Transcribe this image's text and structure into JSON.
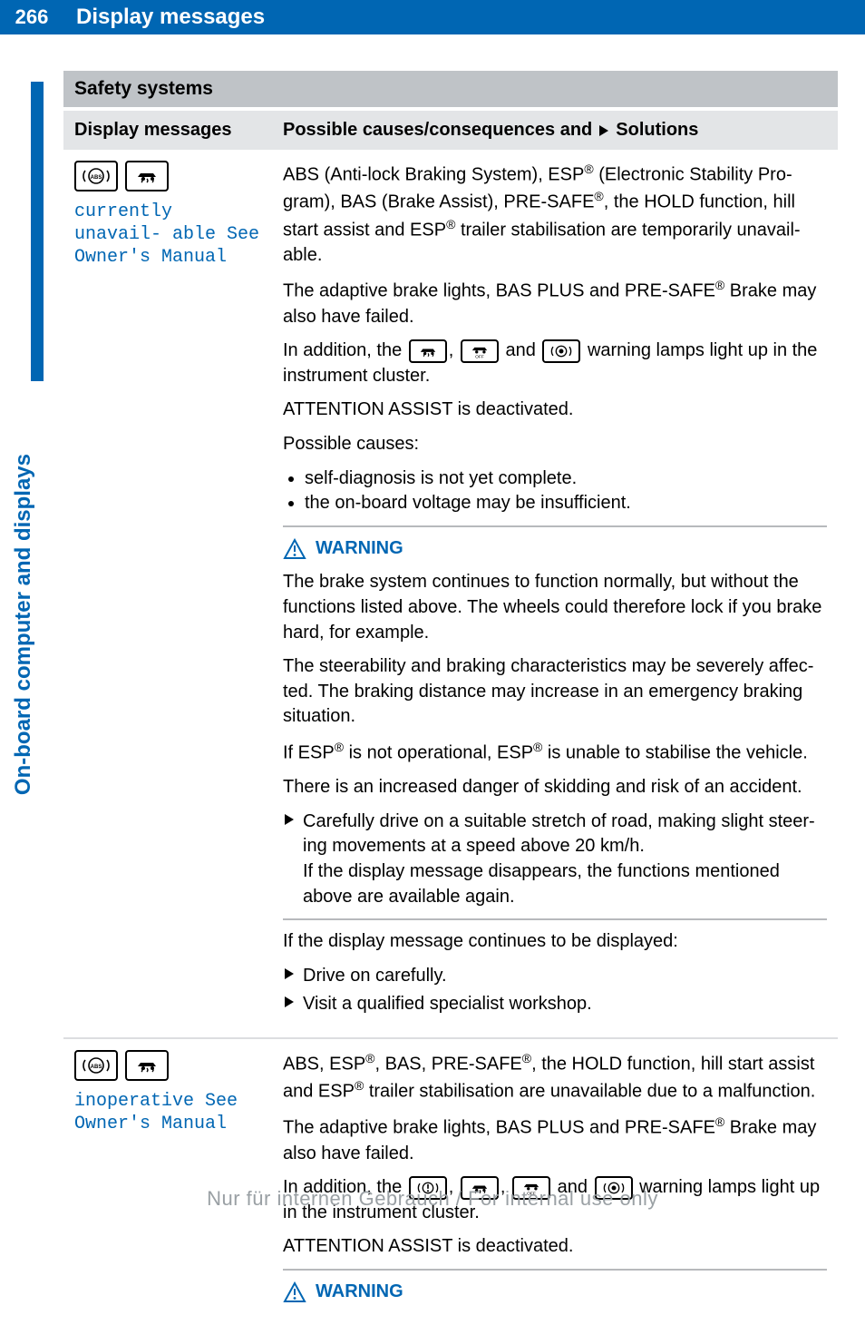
{
  "page_number": "266",
  "page_title": "Display messages",
  "side_tab": "On-board computer and displays",
  "section_heading": "Safety systems",
  "table_header_left": "Display messages",
  "table_header_right_prefix": "Possible causes/consequences and",
  "table_header_right_suffix": "Solutions",
  "warning_label": "WARNING",
  "row1": {
    "display_text": "currently unavail‐ able See Owner's Manual",
    "p1_a": "ABS (Anti-lock Braking System), ESP",
    "p1_b": " (Electronic Stability Pro‐ gram), BAS (Brake Assist), PRE-SAFE",
    "p1_c": ", the HOLD function, hill start assist and ESP",
    "p1_d": " trailer stabilisation are temporarily unavail‐ able.",
    "p2_a": "The adaptive brake lights, BAS PLUS and PRE-SAFE",
    "p2_b": " Brake may also have failed.",
    "p3_a": "In addition, the ",
    "p3_b": " and ",
    "p3_c": " warning lamps light up in the instrument cluster.",
    "p4": "ATTENTION ASSIST is deactivated.",
    "p5": "Possible causes:",
    "cause1": "self-diagnosis is not yet complete.",
    "cause2": "the on-board voltage may be insufficient.",
    "w1": "The brake system continues to function normally, but without the functions listed above. The wheels could therefore lock if you brake hard, for example.",
    "w2": "The steerability and braking characteristics may be severely affec‐ ted. The braking distance may increase in an emergency braking situation.",
    "w3_a": "If ESP",
    "w3_b": " is not operational, ESP",
    "w3_c": " is unable to stabilise the vehicle.",
    "w4": "There is an increased danger of skidding and risk of an accident.",
    "a1": "Carefully drive on a suitable stretch of road, making slight steer‐ ing movements at a speed above 20 km/h.\nIf the display message disappears, the functions mentioned above are available again.",
    "p6": "If the display message continues to be displayed:",
    "a2": "Drive on carefully.",
    "a3": "Visit a qualified specialist workshop."
  },
  "row2": {
    "display_text": "inoperative See Owner's Manual",
    "p1_a": "ABS, ESP",
    "p1_b": ", BAS, PRE-SAFE",
    "p1_c": ", the HOLD function, hill start assist and ESP",
    "p1_d": " trailer stabilisation are unavailable due to a malfunction.",
    "p2_a": "The adaptive brake lights, BAS PLUS and PRE-SAFE",
    "p2_b": " Brake may also have failed.",
    "p3_a": "In addition, the ",
    "p3_b": " and ",
    "p3_c": " warning lamps light up in the instrument cluster.",
    "p4": "ATTENTION ASSIST is deactivated."
  },
  "icons": {
    "abs": "abs-icon",
    "car_skid": "car-skid-icon",
    "car_skid_off": "car-skid-off-icon",
    "brake_circle": "brake-circle-icon",
    "warning_circle": "warning-circle-icon"
  },
  "footer": "Nur für internen Gebrauch / For internal use only"
}
